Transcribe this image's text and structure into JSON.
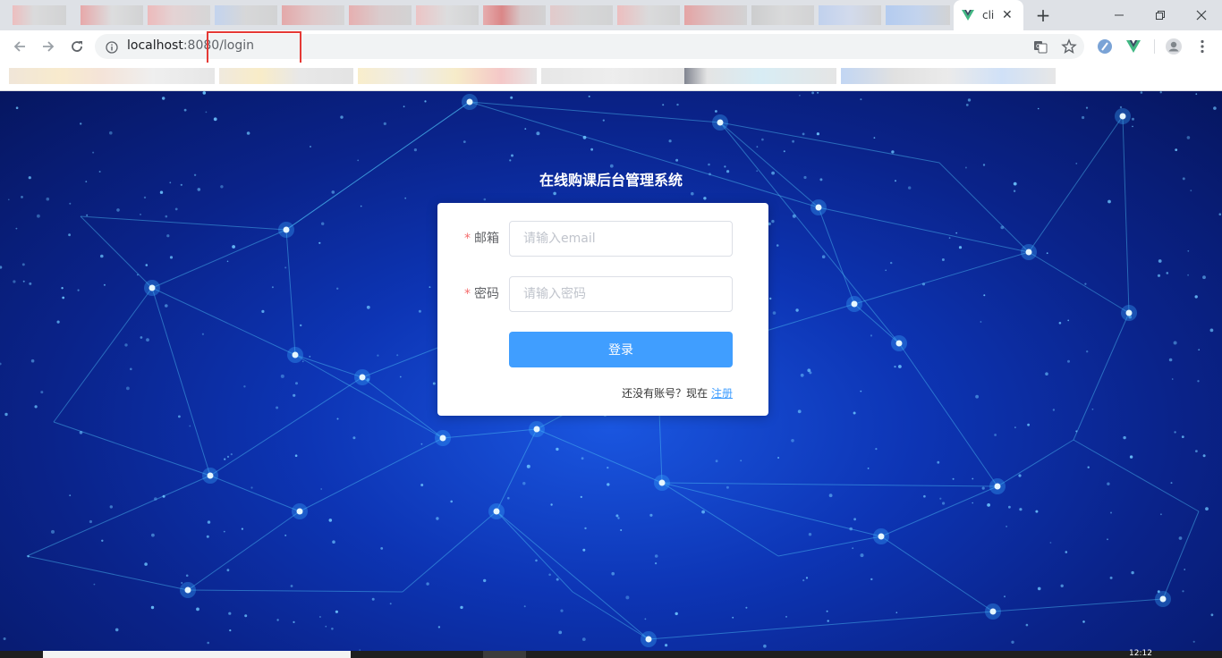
{
  "browser": {
    "tab_title": "cli",
    "url_host": "localhost",
    "url_port": ":8080",
    "url_path": "/login",
    "tab_favicon": "vue-logo-icon",
    "icons": [
      "back-arrow-icon",
      "forward-arrow-icon",
      "reload-icon",
      "info-icon",
      "translate-icon",
      "star-icon",
      "extension-icon",
      "vue-devtools-icon",
      "profile-icon",
      "menu-icon"
    ],
    "colors": {
      "tabstrip": "#dee1e6",
      "omnibox": "#f1f3f4",
      "highlight": "#e53935"
    }
  },
  "page": {
    "system_title": "在线购课后台管理系统",
    "form": {
      "email_label": "邮箱",
      "email_placeholder": "请输入email",
      "email_value": "",
      "password_label": "密码",
      "password_placeholder": "请输入密码",
      "password_value": "",
      "required_mark": "*",
      "login_button": "登录",
      "register_prompt": "还没有账号？现在",
      "register_link": "注册"
    },
    "colors": {
      "primary": "#409eff",
      "required": "#f56c6c",
      "background": "#0d35b5"
    }
  },
  "taskbar": {
    "clock": "12:12"
  }
}
